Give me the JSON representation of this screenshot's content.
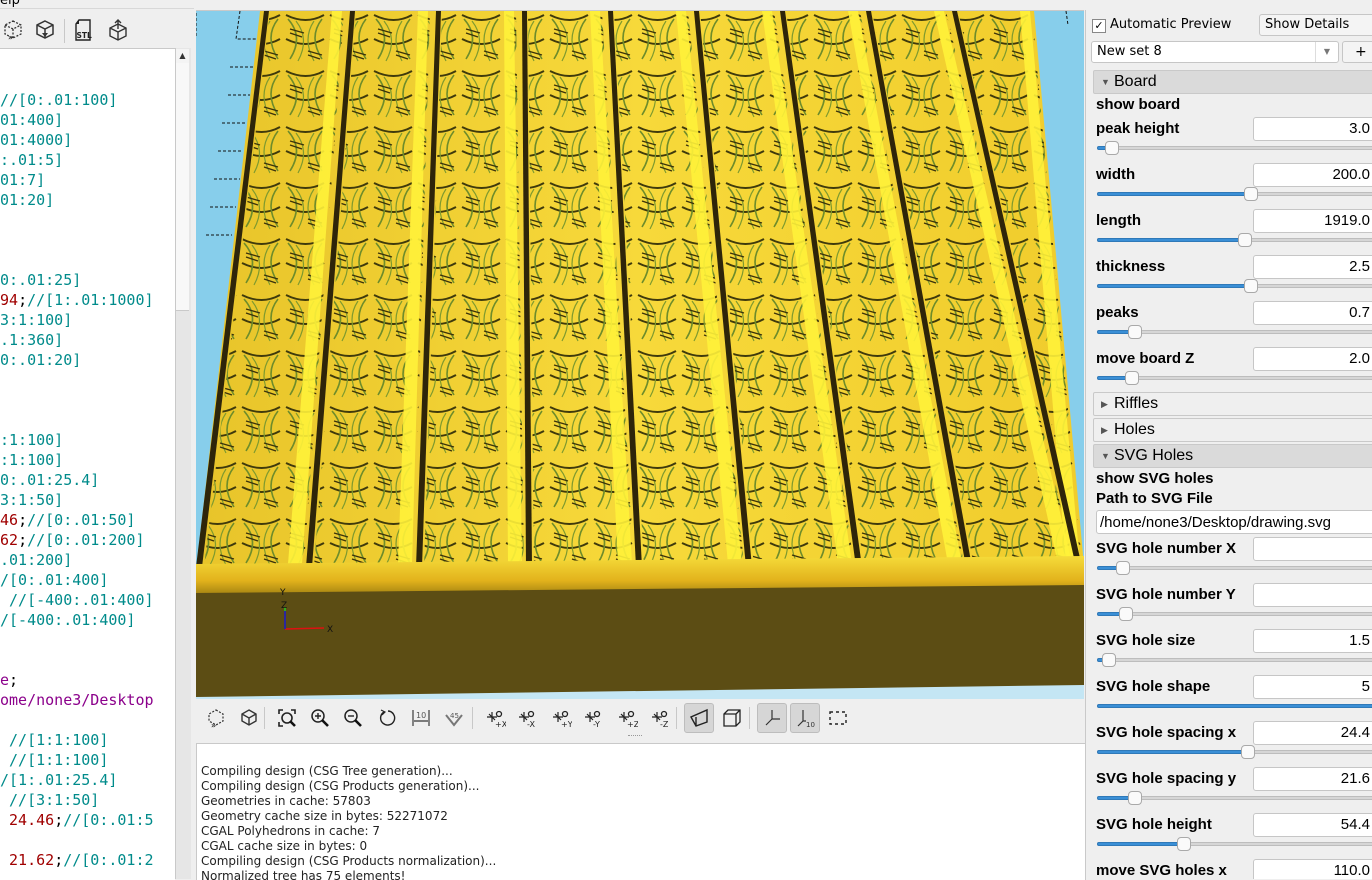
{
  "menubar": {
    "partial_item": "elp"
  },
  "editor_toolbar": {
    "icons": [
      "preview-icon",
      "render-icon",
      "export-stl-icon",
      "send-to-print-icon"
    ],
    "stl_label": "STL"
  },
  "editor": {
    "lines": [
      {
        "parts": [
          {
            "t": "//[0:.01:100]",
            "c": "com"
          }
        ]
      },
      {
        "parts": [
          {
            "t": "01:400]",
            "c": "com"
          }
        ]
      },
      {
        "parts": [
          {
            "t": "01:4000]",
            "c": "com"
          }
        ]
      },
      {
        "parts": [
          {
            "t": ":.01:5]",
            "c": "com"
          }
        ]
      },
      {
        "parts": [
          {
            "t": "01:7]",
            "c": "com"
          }
        ]
      },
      {
        "parts": [
          {
            "t": "01:20]",
            "c": "com"
          }
        ]
      },
      {
        "parts": []
      },
      {
        "parts": []
      },
      {
        "parts": []
      },
      {
        "parts": [
          {
            "t": "0:.01:25]",
            "c": "com"
          }
        ]
      },
      {
        "parts": [
          {
            "t": "94",
            "c": "num"
          },
          {
            "t": ";",
            "c": "def"
          },
          {
            "t": "//[1:.01:1000]",
            "c": "com"
          }
        ]
      },
      {
        "parts": [
          {
            "t": "3:1:100]",
            "c": "com"
          }
        ]
      },
      {
        "parts": [
          {
            "t": ".1:360]",
            "c": "com"
          }
        ]
      },
      {
        "parts": [
          {
            "t": "0:.01:20]",
            "c": "com"
          }
        ]
      },
      {
        "parts": []
      },
      {
        "parts": []
      },
      {
        "parts": []
      },
      {
        "parts": [
          {
            "t": ":1:100]",
            "c": "com"
          }
        ]
      },
      {
        "parts": [
          {
            "t": ":1:100]",
            "c": "com"
          }
        ]
      },
      {
        "parts": [
          {
            "t": "0:.01:25.4]",
            "c": "com"
          }
        ]
      },
      {
        "parts": [
          {
            "t": "3:1:50]",
            "c": "com"
          }
        ]
      },
      {
        "parts": [
          {
            "t": "46",
            "c": "num"
          },
          {
            "t": ";",
            "c": "def"
          },
          {
            "t": "//[0:.01:50]",
            "c": "com"
          }
        ]
      },
      {
        "parts": [
          {
            "t": "62",
            "c": "num"
          },
          {
            "t": ";",
            "c": "def"
          },
          {
            "t": "//[0:.01:200]",
            "c": "com"
          }
        ]
      },
      {
        "parts": [
          {
            "t": ".01:200]",
            "c": "com"
          }
        ]
      },
      {
        "parts": [
          {
            "t": "/[0:.01:400]",
            "c": "com"
          }
        ]
      },
      {
        "parts": [
          {
            "t": " //[-400:.01:400]",
            "c": "com"
          }
        ]
      },
      {
        "parts": [
          {
            "t": "/[-400:.01:400]",
            "c": "com"
          }
        ]
      },
      {
        "parts": []
      },
      {
        "parts": []
      },
      {
        "parts": [
          {
            "t": "e",
            "c": "str"
          },
          {
            "t": ";",
            "c": "def"
          }
        ]
      },
      {
        "parts": [
          {
            "t": "ome/none3/Desktop",
            "c": "str"
          }
        ]
      },
      {
        "parts": []
      },
      {
        "parts": [
          {
            "t": " //[1:1:100]",
            "c": "com"
          }
        ]
      },
      {
        "parts": [
          {
            "t": " //[1:1:100]",
            "c": "com"
          }
        ]
      },
      {
        "parts": [
          {
            "t": "/[1:.01:25.4]",
            "c": "com"
          }
        ]
      },
      {
        "parts": [
          {
            "t": " //[3:1:50]",
            "c": "com"
          }
        ]
      },
      {
        "parts": [
          {
            "t": " 24.46",
            "c": "num"
          },
          {
            "t": ";",
            "c": "def"
          },
          {
            "t": "//[0:.01:5",
            "c": "com"
          }
        ]
      },
      {
        "parts": []
      },
      {
        "parts": [
          {
            "t": " 21.62",
            "c": "num"
          },
          {
            "t": ";",
            "c": "def"
          },
          {
            "t": "//[0:.01:2",
            "c": "com"
          }
        ]
      }
    ]
  },
  "viewport": {
    "axis_labels": {
      "x": "X",
      "y": "Y",
      "z": "Z"
    },
    "colors": {
      "sky": "#87ceeb",
      "board_top": "#f5d22a",
      "board_side": "#5c4d14",
      "groove": "#2e250a",
      "pattern": "#6e8c2a"
    }
  },
  "view_toolbar": {
    "buttons": [
      {
        "name": "preview-button",
        "icon": "preview-icon"
      },
      {
        "name": "render-button",
        "icon": "render-icon"
      },
      {
        "name": "view-all-button",
        "icon": "view-all-icon"
      },
      {
        "name": "zoom-in-button",
        "icon": "zoom-in-icon"
      },
      {
        "name": "zoom-out-button",
        "icon": "zoom-out-icon"
      },
      {
        "name": "reset-view-button",
        "icon": "reset-view-icon"
      },
      {
        "name": "measure-distance-button",
        "icon": "measure-distance-icon",
        "label": "10"
      },
      {
        "name": "measure-angle-button",
        "icon": "measure-angle-icon",
        "label": "45"
      },
      {
        "name": "view-right-button",
        "icon": "view-right-icon",
        "label": "+X"
      },
      {
        "name": "view-left-button",
        "icon": "view-left-icon",
        "label": "-X"
      },
      {
        "name": "view-back-button",
        "icon": "view-back-icon",
        "label": "+Y"
      },
      {
        "name": "view-front-button",
        "icon": "view-front-icon",
        "label": "-Y"
      },
      {
        "name": "view-top-button",
        "icon": "view-top-icon",
        "label": "+Z"
      },
      {
        "name": "view-bottom-button",
        "icon": "view-bottom-icon",
        "label": "-Z"
      },
      {
        "name": "perspective-button",
        "icon": "perspective-icon",
        "active": true
      },
      {
        "name": "orthogonal-button",
        "icon": "orthogonal-icon",
        "active": false
      },
      {
        "name": "show-axes-button",
        "icon": "axes-icon",
        "active": true
      },
      {
        "name": "show-scale-markers-button",
        "icon": "scale-markers-icon",
        "active": true,
        "label": "10"
      },
      {
        "name": "show-edges-button",
        "icon": "edges-icon",
        "active": false
      }
    ]
  },
  "console": {
    "lines": [
      "Compiling design (CSG Tree generation)...",
      "Compiling design (CSG Products generation)...",
      "Geometries in cache: 57803",
      "Geometry cache size in bytes: 52271072",
      "CGAL Polyhedrons in cache: 7",
      "CGAL cache size in bytes: 0",
      "Compiling design (CSG Products normalization)...",
      "Normalized tree has 75 elements!"
    ]
  },
  "customizer": {
    "automatic_preview": {
      "label": "Automatic Preview",
      "checked": true
    },
    "details_select": "Show Details",
    "preset_select": "New set 8",
    "add_preset_label": "+",
    "groups": {
      "board": {
        "title": "Board",
        "open": true
      },
      "riffles": {
        "title": "Riffles",
        "open": false
      },
      "holes": {
        "title": "Holes",
        "open": false
      },
      "svg_holes": {
        "title": "SVG Holes",
        "open": true
      }
    },
    "board": {
      "show_board": "show board",
      "params": [
        {
          "label": "peak height",
          "value": "3.0",
          "fraction": 0.05
        },
        {
          "label": "width",
          "value": "200.0",
          "fraction": 0.53
        },
        {
          "label": "length",
          "value": "1919.0",
          "fraction": 0.51
        },
        {
          "label": "thickness",
          "value": "2.5",
          "fraction": 0.53
        },
        {
          "label": "peaks",
          "value": "0.7",
          "fraction": 0.13
        },
        {
          "label": "move board Z",
          "value": "2.0",
          "fraction": 0.12
        }
      ]
    },
    "svg": {
      "show_svg_holes": "show SVG holes",
      "path_label": "Path to SVG File",
      "path_value": "/home/none3/Desktop/drawing.svg",
      "params": [
        {
          "label": "SVG hole number X",
          "value": "",
          "fraction": 0.09
        },
        {
          "label": "SVG hole number Y",
          "value": "",
          "fraction": 0.1
        },
        {
          "label": "SVG hole size",
          "value": "1.5",
          "fraction": 0.04
        },
        {
          "label": "SVG hole shape",
          "value": "5",
          "fraction": 1.0
        },
        {
          "label": "SVG hole spacing x",
          "value": "24.4",
          "fraction": 0.52
        },
        {
          "label": "SVG hole spacing y",
          "value": "21.6",
          "fraction": 0.13
        },
        {
          "label": "SVG hole height",
          "value": "54.4",
          "fraction": 0.3
        },
        {
          "label": "move SVG holes x",
          "value": "110.0",
          "fraction": null
        }
      ]
    }
  }
}
